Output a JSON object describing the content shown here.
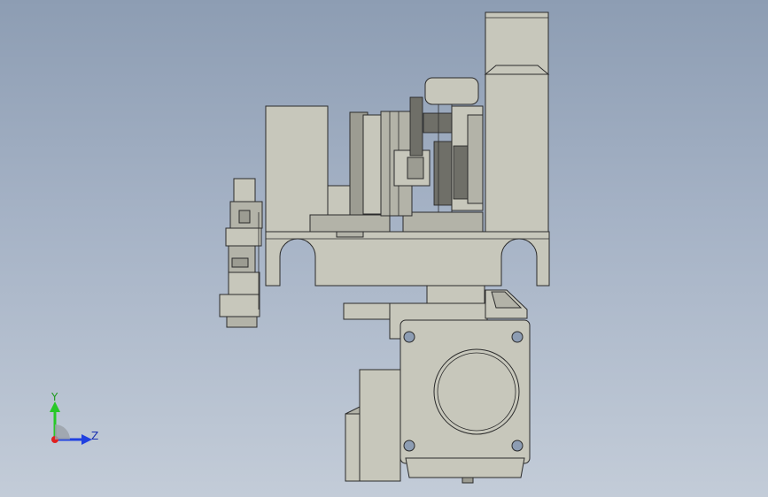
{
  "viewport": {
    "background_top": "#8d9db3",
    "background_bottom": "#c3ccd8",
    "part_color": "#c7c7bb",
    "edge_color": "#2b2b2b"
  },
  "triad": {
    "y_label": "Y",
    "z_label": "Z",
    "y_color": "#28c828",
    "z_color": "#2040e0",
    "x_color": "#e02020"
  }
}
